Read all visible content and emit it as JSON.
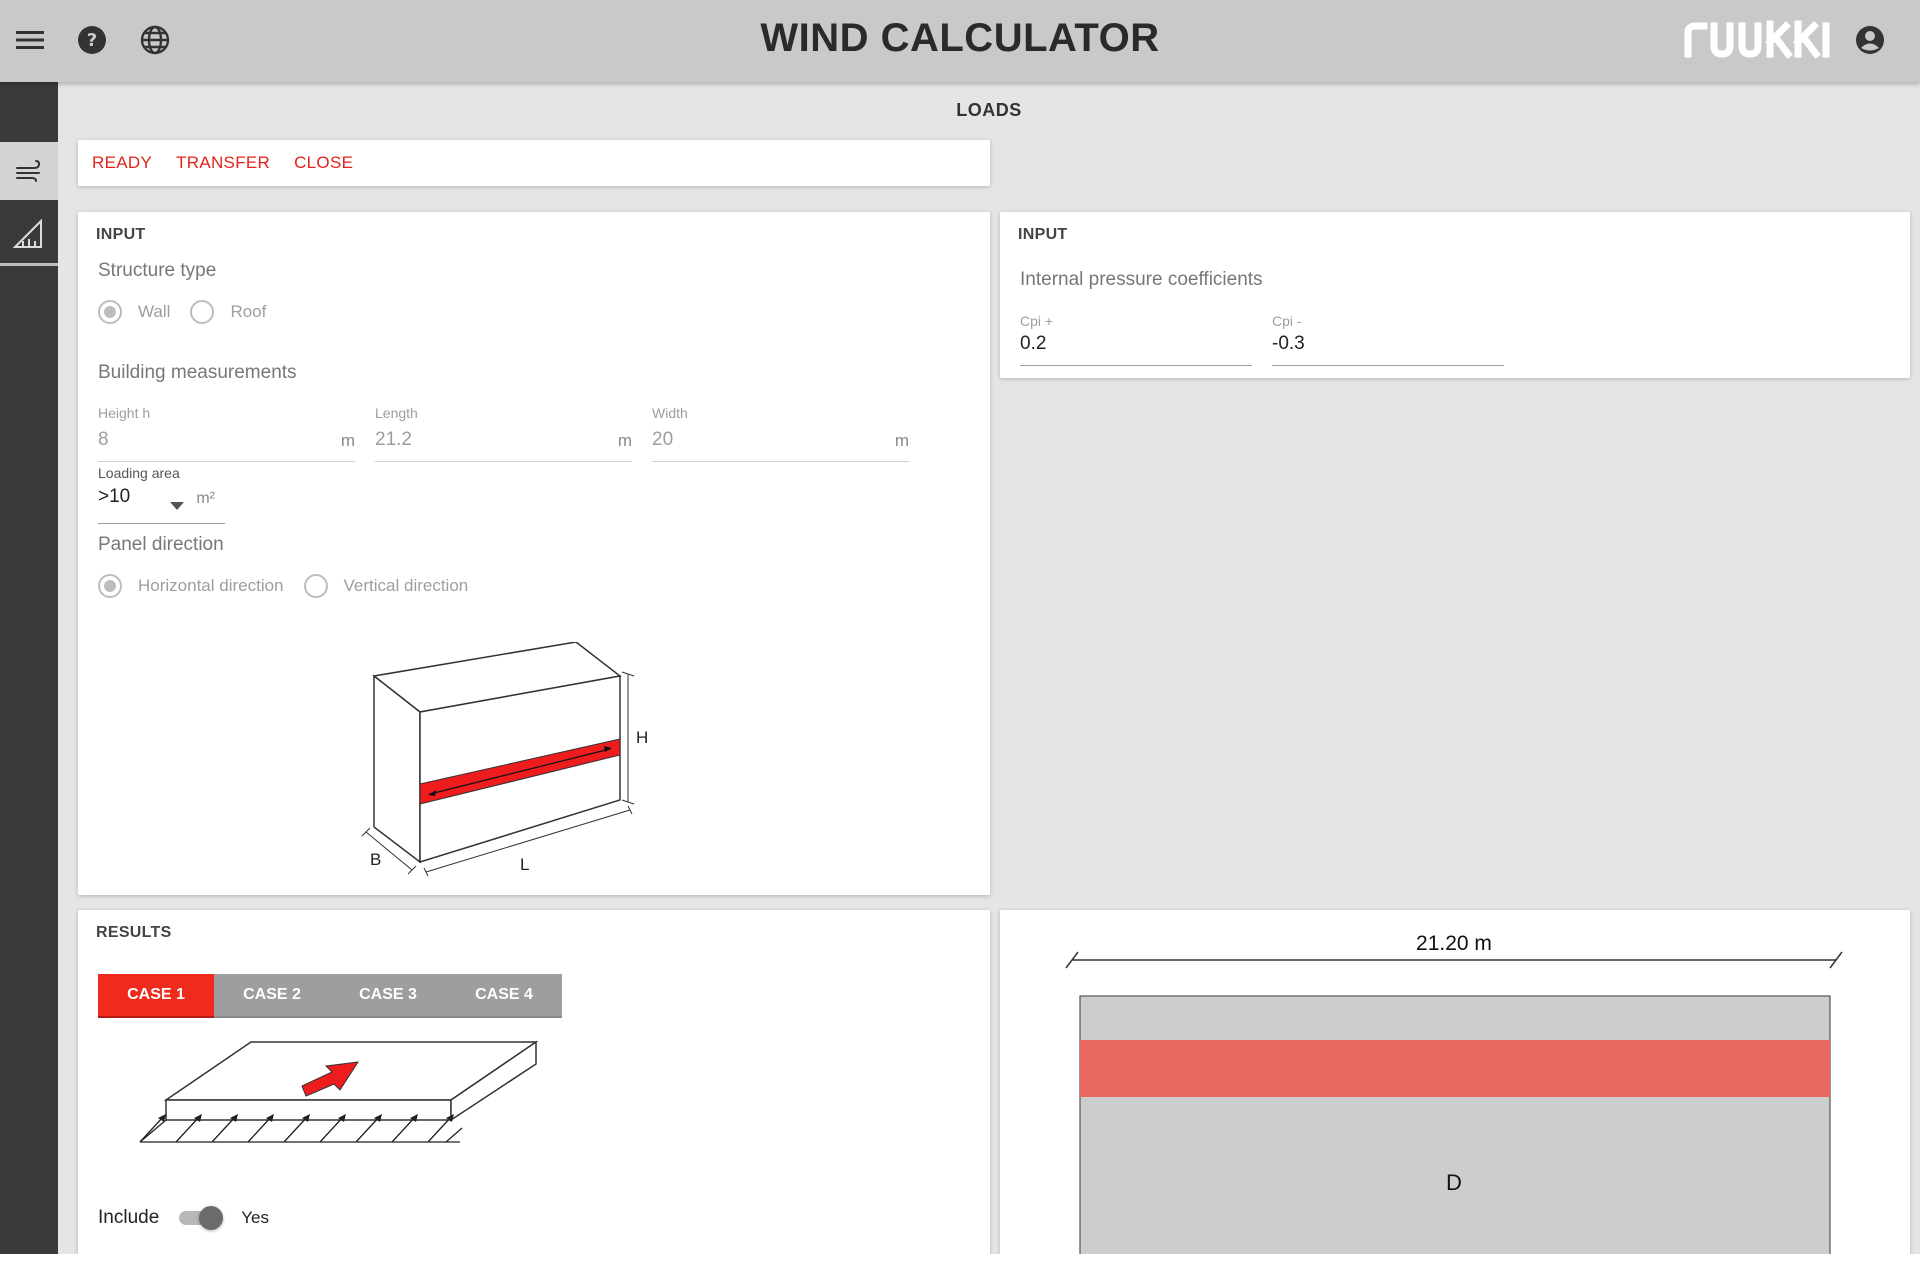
{
  "header": {
    "title": "WIND CALCULATOR",
    "brand": "ruukki",
    "icons": [
      "menu-icon",
      "help-icon",
      "globe-icon",
      "account-icon"
    ]
  },
  "sidebar": {
    "items": [
      {
        "icon": "wind-icon",
        "active": true
      },
      {
        "icon": "measure-icon",
        "active": false
      }
    ]
  },
  "page": {
    "section_title": "LOADS"
  },
  "actions": {
    "ready": "READY",
    "transfer": "TRANSFER",
    "close": "CLOSE"
  },
  "input_left": {
    "title": "INPUT",
    "structure_type": {
      "label": "Structure type",
      "options": [
        "Wall",
        "Roof"
      ],
      "selected": "Wall"
    },
    "building": {
      "label": "Building measurements",
      "height": {
        "label": "Height h",
        "value": "8",
        "unit": "m"
      },
      "length": {
        "label": "Length",
        "value": "21.2",
        "unit": "m"
      },
      "width": {
        "label": "Width",
        "value": "20",
        "unit": "m"
      }
    },
    "loading_area": {
      "label": "Loading area",
      "value": ">10",
      "unit": "m²"
    },
    "panel_direction": {
      "label": "Panel direction",
      "options": [
        "Horizontal direction",
        "Vertical direction"
      ],
      "selected": "Horizontal direction"
    },
    "diagram": {
      "h_label": "H",
      "b_label": "B",
      "l_label": "L"
    }
  },
  "input_right": {
    "title": "INPUT",
    "group_label": "Internal pressure coefficients",
    "cpi_plus": {
      "label": "Cpi +",
      "value": "0.2"
    },
    "cpi_minus": {
      "label": "Cpi -",
      "value": "-0.3"
    }
  },
  "results": {
    "title": "RESULTS",
    "tabs": [
      "CASE 1",
      "CASE 2",
      "CASE 3",
      "CASE 4"
    ],
    "active_tab": "CASE 1",
    "include": {
      "label": "Include",
      "value": "Yes",
      "on": true
    }
  },
  "zone_view": {
    "dimension": "21.20 m",
    "zone_label": "D"
  },
  "colors": {
    "accent": "#e2231a",
    "tab_active": "#ef2b1e",
    "band": "#e8685f",
    "zone_fill": "#cdcdcd"
  }
}
